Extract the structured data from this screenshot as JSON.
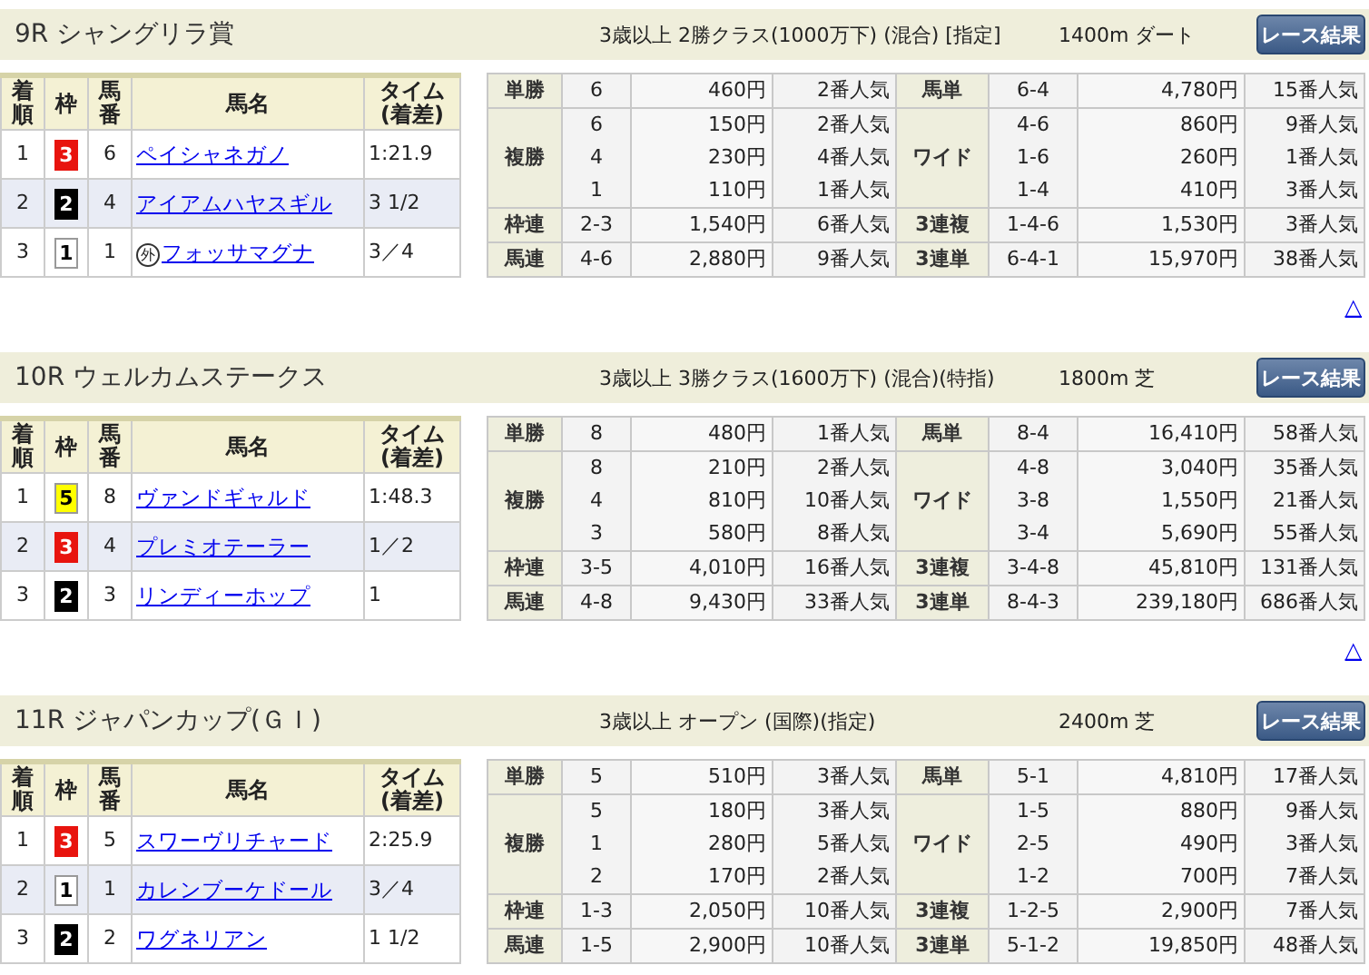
{
  "races": [
    {
      "title": "9R シャングリラ賞",
      "conditions": "3歳以上 2勝クラス(1000万下) (混合) [指定]",
      "distance": "1400m ダート",
      "button": "レース結果",
      "top_link": "△",
      "result_header": {
        "rank": "着順",
        "frame": "枠",
        "number": "馬番",
        "name": "馬名",
        "time": "タイム\n(着差)"
      },
      "results": [
        {
          "rank": "1",
          "frame": "3",
          "color": "#e8140e",
          "number": "6",
          "name": "ペイシャネガノ",
          "time": "1:21.9"
        },
        {
          "rank": "2",
          "frame": "2",
          "color": "#000000",
          "number": "4",
          "name": "アイアムハヤスギル",
          "time": "3 1/2"
        },
        {
          "rank": "3",
          "frame": "1",
          "color": "#ffffff",
          "number": "1",
          "mark": "外",
          "name": "フォッサマグナ",
          "time": "3／4"
        }
      ],
      "payouts": [
        {
          "left": {
            "label": "単勝",
            "lines": [
              {
                "combo": "6",
                "amount": "460円",
                "pop": "2番人気"
              }
            ]
          },
          "right": {
            "label": "馬単",
            "lines": [
              {
                "combo": "6-4",
                "amount": "4,780円",
                "pop": "15番人気"
              }
            ]
          }
        },
        {
          "left": {
            "label": "複勝",
            "lines": [
              {
                "combo": "6",
                "amount": "150円",
                "pop": "2番人気"
              },
              {
                "combo": "4",
                "amount": "230円",
                "pop": "4番人気"
              },
              {
                "combo": "1",
                "amount": "110円",
                "pop": "1番人気"
              }
            ]
          },
          "right": {
            "label": "ワイド",
            "lines": [
              {
                "combo": "4-6",
                "amount": "860円",
                "pop": "9番人気"
              },
              {
                "combo": "1-6",
                "amount": "260円",
                "pop": "1番人気"
              },
              {
                "combo": "1-4",
                "amount": "410円",
                "pop": "3番人気"
              }
            ]
          }
        },
        {
          "left": {
            "label": "枠連",
            "lines": [
              {
                "combo": "2-3",
                "amount": "1,540円",
                "pop": "6番人気"
              }
            ]
          },
          "right": {
            "label": "3連複",
            "lines": [
              {
                "combo": "1-4-6",
                "amount": "1,530円",
                "pop": "3番人気"
              }
            ]
          }
        },
        {
          "left": {
            "label": "馬連",
            "lines": [
              {
                "combo": "4-6",
                "amount": "2,880円",
                "pop": "9番人気"
              }
            ]
          },
          "right": {
            "label": "3連単",
            "lines": [
              {
                "combo": "6-4-1",
                "amount": "15,970円",
                "pop": "38番人気"
              }
            ]
          }
        }
      ]
    },
    {
      "title": "10R ウェルカムステークス",
      "conditions": "3歳以上 3勝クラス(1600万下) (混合)(特指)",
      "distance": "1800m 芝",
      "button": "レース結果",
      "top_link": "△",
      "result_header": {
        "rank": "着順",
        "frame": "枠",
        "number": "馬番",
        "name": "馬名",
        "time": "タイム\n(着差)"
      },
      "results": [
        {
          "rank": "1",
          "frame": "5",
          "color": "#ffff00",
          "number": "8",
          "name": "ヴァンドギャルド",
          "time": "1:48.3"
        },
        {
          "rank": "2",
          "frame": "3",
          "color": "#e8140e",
          "number": "4",
          "name": "プレミオテーラー",
          "time": "1／2"
        },
        {
          "rank": "3",
          "frame": "2",
          "color": "#000000",
          "number": "3",
          "name": "リンディーホップ",
          "time": "1"
        }
      ],
      "payouts": [
        {
          "left": {
            "label": "単勝",
            "lines": [
              {
                "combo": "8",
                "amount": "480円",
                "pop": "1番人気"
              }
            ]
          },
          "right": {
            "label": "馬単",
            "lines": [
              {
                "combo": "8-4",
                "amount": "16,410円",
                "pop": "58番人気"
              }
            ]
          }
        },
        {
          "left": {
            "label": "複勝",
            "lines": [
              {
                "combo": "8",
                "amount": "210円",
                "pop": "2番人気"
              },
              {
                "combo": "4",
                "amount": "810円",
                "pop": "10番人気"
              },
              {
                "combo": "3",
                "amount": "580円",
                "pop": "8番人気"
              }
            ]
          },
          "right": {
            "label": "ワイド",
            "lines": [
              {
                "combo": "4-8",
                "amount": "3,040円",
                "pop": "35番人気"
              },
              {
                "combo": "3-8",
                "amount": "1,550円",
                "pop": "21番人気"
              },
              {
                "combo": "3-4",
                "amount": "5,690円",
                "pop": "55番人気"
              }
            ]
          }
        },
        {
          "left": {
            "label": "枠連",
            "lines": [
              {
                "combo": "3-5",
                "amount": "4,010円",
                "pop": "16番人気"
              }
            ]
          },
          "right": {
            "label": "3連複",
            "lines": [
              {
                "combo": "3-4-8",
                "amount": "45,810円",
                "pop": "131番人気"
              }
            ]
          }
        },
        {
          "left": {
            "label": "馬連",
            "lines": [
              {
                "combo": "4-8",
                "amount": "9,430円",
                "pop": "33番人気"
              }
            ]
          },
          "right": {
            "label": "3連単",
            "lines": [
              {
                "combo": "8-4-3",
                "amount": "239,180円",
                "pop": "686番人気"
              }
            ]
          }
        }
      ]
    },
    {
      "title": "11R ジャパンカップ(ＧＩ)",
      "conditions": "3歳以上 オープン (国際)(指定)",
      "distance": "2400m 芝",
      "button": "レース結果",
      "result_header": {
        "rank": "着順",
        "frame": "枠",
        "number": "馬番",
        "name": "馬名",
        "time": "タイム\n(着差)"
      },
      "results": [
        {
          "rank": "1",
          "frame": "3",
          "color": "#e8140e",
          "number": "5",
          "name": "スワーヴリチャード",
          "time": "2:25.9"
        },
        {
          "rank": "2",
          "frame": "1",
          "color": "#ffffff",
          "number": "1",
          "name": "カレンブーケドール",
          "time": "3／4"
        },
        {
          "rank": "3",
          "frame": "2",
          "color": "#000000",
          "number": "2",
          "name": "ワグネリアン",
          "time": "1 1/2"
        }
      ],
      "payouts": [
        {
          "left": {
            "label": "単勝",
            "lines": [
              {
                "combo": "5",
                "amount": "510円",
                "pop": "3番人気"
              }
            ]
          },
          "right": {
            "label": "馬単",
            "lines": [
              {
                "combo": "5-1",
                "amount": "4,810円",
                "pop": "17番人気"
              }
            ]
          }
        },
        {
          "left": {
            "label": "複勝",
            "lines": [
              {
                "combo": "5",
                "amount": "180円",
                "pop": "3番人気"
              },
              {
                "combo": "1",
                "amount": "280円",
                "pop": "5番人気"
              },
              {
                "combo": "2",
                "amount": "170円",
                "pop": "2番人気"
              }
            ]
          },
          "right": {
            "label": "ワイド",
            "lines": [
              {
                "combo": "1-5",
                "amount": "880円",
                "pop": "9番人気"
              },
              {
                "combo": "2-5",
                "amount": "490円",
                "pop": "3番人気"
              },
              {
                "combo": "1-2",
                "amount": "700円",
                "pop": "7番人気"
              }
            ]
          }
        },
        {
          "left": {
            "label": "枠連",
            "lines": [
              {
                "combo": "1-3",
                "amount": "2,050円",
                "pop": "10番人気"
              }
            ]
          },
          "right": {
            "label": "3連複",
            "lines": [
              {
                "combo": "1-2-5",
                "amount": "2,900円",
                "pop": "7番人気"
              }
            ]
          }
        },
        {
          "left": {
            "label": "馬連",
            "lines": [
              {
                "combo": "1-5",
                "amount": "2,900円",
                "pop": "10番人気"
              }
            ]
          },
          "right": {
            "label": "3連単",
            "lines": [
              {
                "combo": "5-1-2",
                "amount": "19,850円",
                "pop": "48番人気"
              }
            ]
          }
        }
      ]
    }
  ]
}
